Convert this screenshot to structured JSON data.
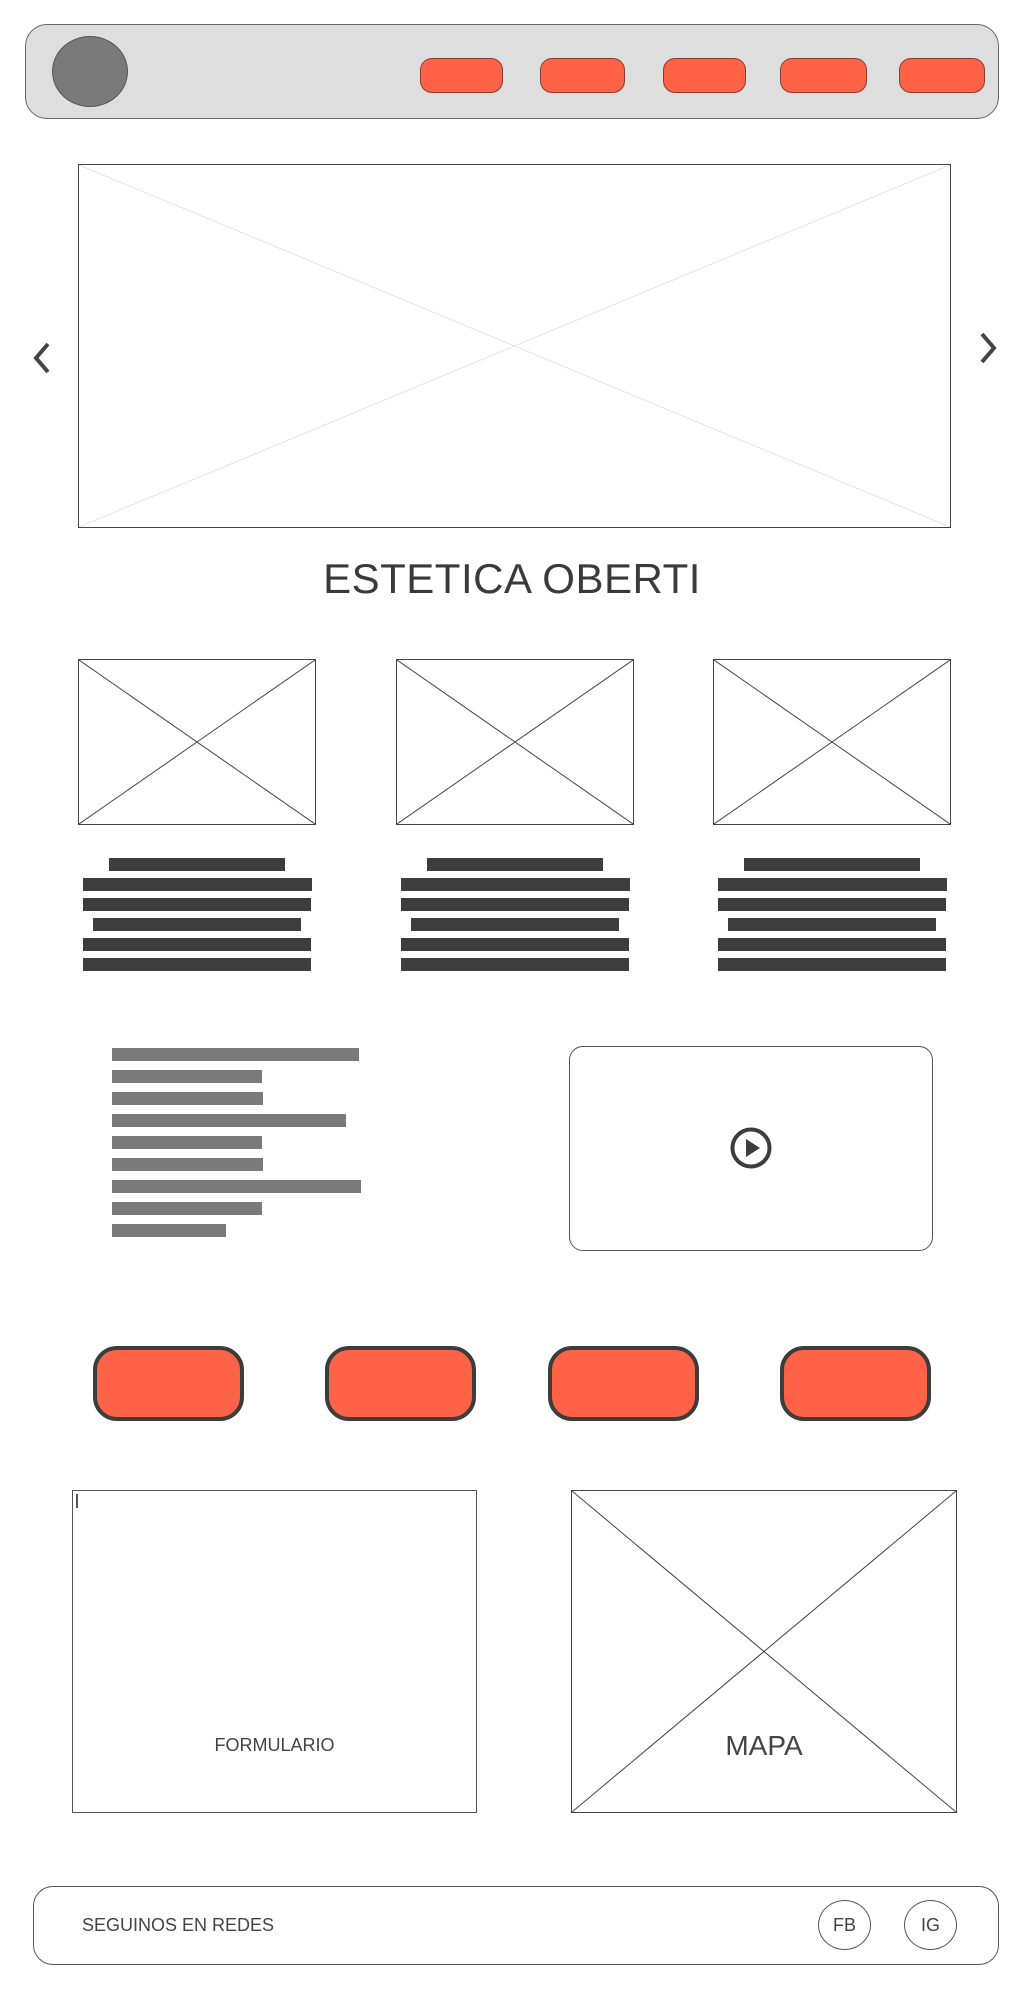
{
  "header": {
    "logo": "avatar",
    "nav_count": 5
  },
  "carousel": {
    "prev_icon": "chevron-left-icon",
    "next_icon": "chevron-right-icon"
  },
  "hero": {
    "title": "ESTETICA OBERTI"
  },
  "video": {
    "icon": "play-circle-icon"
  },
  "form": {
    "label": "FORMULARIO"
  },
  "map": {
    "label": "MAPA"
  },
  "footer": {
    "text": "SEGUINOS EN REDES",
    "fb": "FB",
    "ig": "IG"
  },
  "colors": {
    "accent": "#ff6347",
    "header_bg": "#dedede",
    "text_dark": "#3d3d3d",
    "text_gray": "#7a7a7a"
  }
}
